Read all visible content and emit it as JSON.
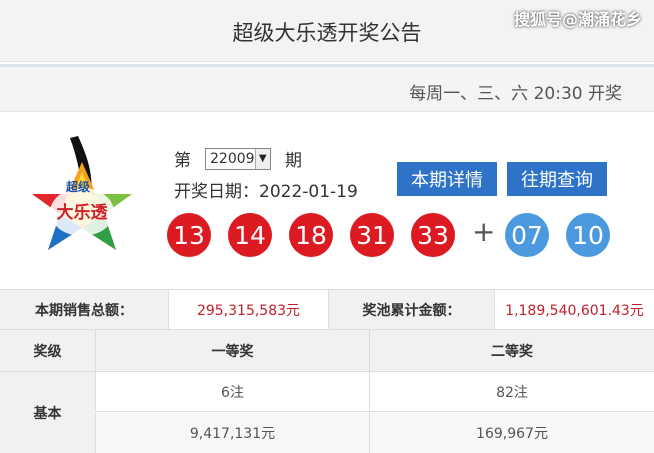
{
  "header": {
    "title": "超级大乐透开奖公告",
    "watermark": "搜狐号@潮涌花乡"
  },
  "schedule": {
    "text": "每周一、三、六 20:30 开奖"
  },
  "logo": {
    "icon": "super-lotto-star-logo",
    "text_top": "超级",
    "text_main": "大乐透"
  },
  "issue": {
    "prefix": "第",
    "selected": "22009",
    "suffix": "期"
  },
  "draw_date": {
    "text": "开奖日期：2022-01-19"
  },
  "buttons": {
    "detail": "本期详情",
    "history": "往期查询"
  },
  "numbers": {
    "front": [
      "13",
      "14",
      "18",
      "31",
      "33"
    ],
    "plus": "+",
    "back": [
      "07",
      "10"
    ],
    "colors": {
      "front": "#dc1a22",
      "back": "#4b9ae0"
    }
  },
  "sales": {
    "sales_label": "本期销售总额：",
    "sales_value": "295,315,583元",
    "pool_label": "奖池累计金额：",
    "pool_value": "1,189,540,601.43元"
  },
  "prize_table": {
    "headers": [
      "奖级",
      "一等奖",
      "二等奖"
    ],
    "row_label": "基本",
    "counts": [
      "6注",
      "82注"
    ],
    "amounts": [
      "9,417,131元",
      "169,967元"
    ]
  }
}
